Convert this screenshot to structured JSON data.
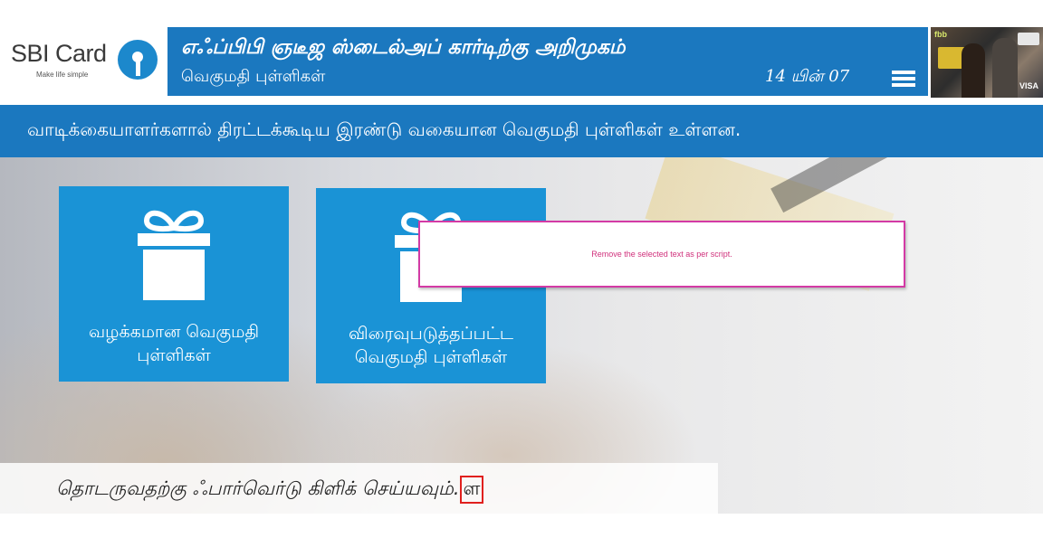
{
  "header": {
    "logo_text": "SBI Card",
    "logo_tagline": "Make life simple",
    "title_main": "எஃப்பிபி ஞடீஜ ஸ்டைல்அப் கார்டிற்கு அறிமுகம்",
    "title_sub": "வெகுமதி புள்ளிகள்",
    "page_counter": "14 யின் 07",
    "menu_icon": "hamburger-icon",
    "thumbnail": {
      "brand": "fbb",
      "card_label": "VISA"
    }
  },
  "subtitle": {
    "text": "வாடிக்கையாளர்களால் திரட்டக்கூடிய இரண்டு வகையான வெகுமதி புள்ளிகள் உள்ளன."
  },
  "tiles": [
    {
      "label": "வழக்கமான வெகுமதி புள்ளிகள்",
      "icon": "gift-icon"
    },
    {
      "label": "விரைவுபடுத்தப்பட்ட வெகுமதி புள்ளிகள்",
      "icon": "gift-icon"
    }
  ],
  "popup": {
    "message": "Remove the selected text as per script."
  },
  "footer": {
    "instruction": "தொடருவதற்கு ஃபார்வெர்டு கிளிக் செய்யவும்.",
    "highlighted_char": "ள"
  },
  "colors": {
    "primary_blue": "#1b78bf",
    "tile_blue": "#1a93d6",
    "popup_border": "#d33aa5",
    "popup_text": "#d0317c",
    "highlight_border": "#e0201e"
  }
}
